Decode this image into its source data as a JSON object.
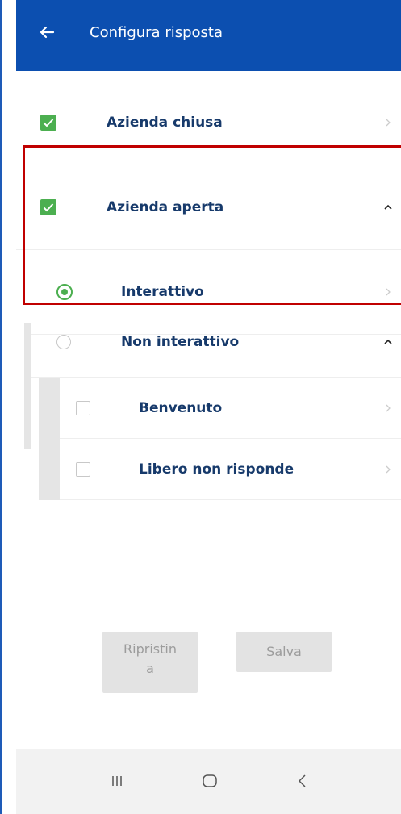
{
  "header": {
    "title": "Configura risposta",
    "back_icon": "arrow-left-icon"
  },
  "rows": [
    {
      "label": "Azienda chiusa",
      "state": "checked",
      "type": "checkbox",
      "trailing": "chevron-right-icon"
    },
    {
      "label": "Azienda aperta",
      "state": "checked",
      "type": "checkbox",
      "trailing": "chevron-up-icon"
    },
    {
      "label": "Interattivo",
      "state": "selected",
      "type": "radio",
      "trailing": "chevron-right-icon"
    },
    {
      "label": "Non interattivo",
      "state": "unselected",
      "type": "radio",
      "trailing": "chevron-up-icon"
    },
    {
      "label": "Benvenuto",
      "state": "unchecked",
      "type": "checkbox",
      "trailing": "chevron-right-icon"
    },
    {
      "label": "Libero non risponde",
      "state": "unchecked",
      "type": "checkbox",
      "trailing": "chevron-right-icon"
    }
  ],
  "buttons": {
    "reset_label_line1": "Ripristin",
    "reset_label_line2": "a",
    "save_label": "Salva"
  },
  "navbar": {
    "items": [
      "recents-icon",
      "home-icon",
      "back-icon"
    ]
  },
  "colors": {
    "appbar": "#0c4fb0",
    "check_green": "#4caf50",
    "label": "#173a6b",
    "highlight_red": "#c00000"
  }
}
